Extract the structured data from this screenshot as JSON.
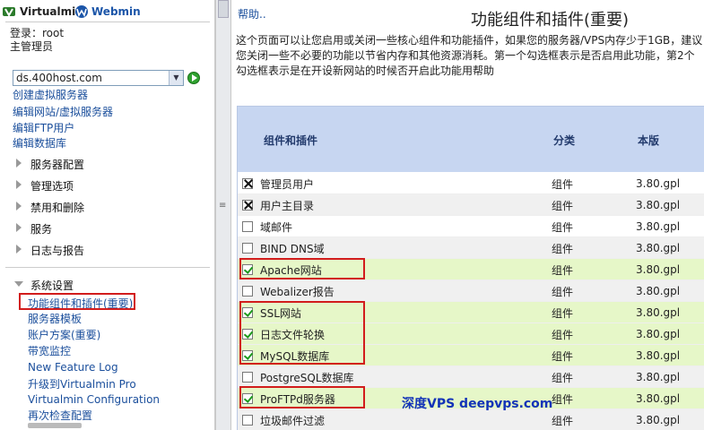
{
  "sidebar": {
    "brand_virtualmin": "Virtualmin",
    "brand_webmin": "Webmin",
    "login_line": "登录：root",
    "role_line": "主管理员",
    "domain_select": "ds.400host.com",
    "links": [
      "创建虚拟服务器",
      "编辑网站/虚拟服务器",
      "编辑FTP用户",
      "编辑数据库"
    ],
    "menus": [
      "服务器配置",
      "管理选项",
      "禁用和删除",
      "服务",
      "日志与报告"
    ],
    "open_menu": "系统设置",
    "submenu": [
      "功能组件和插件(重要)",
      "服务器模板",
      "账户方案(重要)",
      "带宽监控",
      "New Feature Log",
      "升级到Virtualmin Pro",
      "Virtualmin Configuration",
      "再次检查配置"
    ]
  },
  "main": {
    "help": "帮助..",
    "title": "功能组件和插件(重要)",
    "description": "这个页面可以让您启用或关闭一些核心组件和功能插件，如果您的服务器/VPS内存少于1GB，建议您关闭一些不必要的功能以节省内存和其他资源消耗。第一个勾选框表示是否启用此功能，第2个勾选框表示是在开设新网站的时候否开启此功能用帮助",
    "columns": [
      "组件和插件",
      "分类",
      "本版"
    ],
    "rows": [
      {
        "name": "管理员用户",
        "state": "x",
        "category": "组件",
        "version": "3.80.gpl",
        "highlight": false
      },
      {
        "name": "用户主目录",
        "state": "x",
        "category": "组件",
        "version": "3.80.gpl",
        "highlight": false
      },
      {
        "name": "域邮件",
        "state": "empty",
        "category": "组件",
        "version": "3.80.gpl",
        "highlight": false
      },
      {
        "name": "BIND DNS域",
        "state": "empty",
        "category": "组件",
        "version": "3.80.gpl",
        "highlight": false
      },
      {
        "name": "Apache网站",
        "state": "checked",
        "category": "组件",
        "version": "3.80.gpl",
        "highlight": true
      },
      {
        "name": "Webalizer报告",
        "state": "empty",
        "category": "组件",
        "version": "3.80.gpl",
        "highlight": false
      },
      {
        "name": "SSL网站",
        "state": "checked",
        "category": "组件",
        "version": "3.80.gpl",
        "highlight": true
      },
      {
        "name": "日志文件轮换",
        "state": "checked",
        "category": "组件",
        "version": "3.80.gpl",
        "highlight": true
      },
      {
        "name": "MySQL数据库",
        "state": "checked",
        "category": "组件",
        "version": "3.80.gpl",
        "highlight": true
      },
      {
        "name": "PostgreSQL数据库",
        "state": "empty",
        "category": "组件",
        "version": "3.80.gpl",
        "highlight": false
      },
      {
        "name": "ProFTPd服务器",
        "state": "checked",
        "category": "组件",
        "version": "3.80.gpl",
        "highlight": true
      },
      {
        "name": "垃圾邮件过滤",
        "state": "empty",
        "category": "组件",
        "version": "3.80.gpl",
        "highlight": false
      }
    ],
    "watermark": "深度VPS deepvps.com"
  },
  "colors": {
    "row_highlight": "#e6f7c8",
    "row_alt": "#f0f0f0",
    "header_bg": "#c7d6f1",
    "link": "#1b4f9c",
    "annotation": "#d21c1c"
  }
}
